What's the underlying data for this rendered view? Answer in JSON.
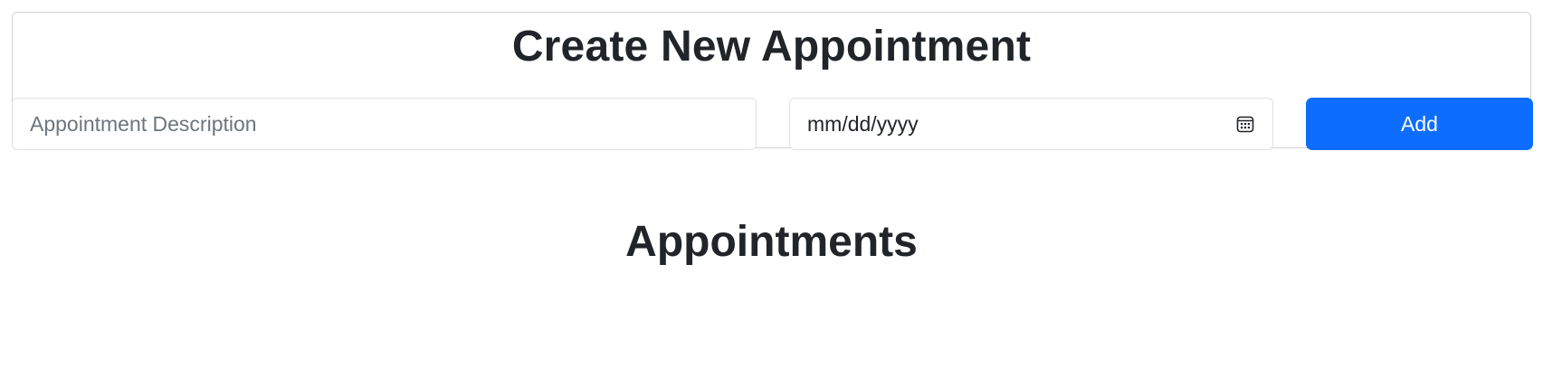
{
  "create_form": {
    "title": "Create New Appointment",
    "description": {
      "placeholder": "Appointment Description",
      "value": ""
    },
    "date": {
      "placeholder": "mm/dd/yyyy",
      "value": ""
    },
    "add_label": "Add"
  },
  "appointments": {
    "title": "Appointments",
    "items": []
  },
  "icons": {
    "date_picker": "calendar-icon"
  },
  "colors": {
    "accent": "#0d6efd",
    "text": "#212529",
    "placeholder": "#6c757d",
    "border": "#dee2e6"
  }
}
